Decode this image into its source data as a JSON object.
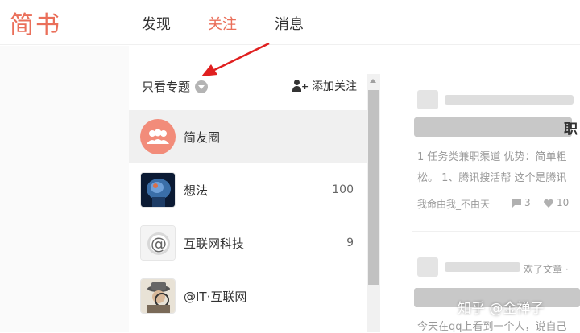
{
  "header": {
    "logo": "简书",
    "nav": [
      {
        "label": "发现",
        "active": false
      },
      {
        "label": "关注",
        "active": true
      },
      {
        "label": "消息",
        "active": false
      }
    ],
    "accent_color": "#ea6f5a"
  },
  "panel": {
    "filter_label": "只看专题",
    "add_follow_label": "添加关注",
    "items": [
      {
        "name": "简友圈",
        "count": "",
        "icon": "users-icon"
      },
      {
        "name": "想法",
        "count": "100",
        "icon": "brain-image"
      },
      {
        "name": "互联网科技",
        "count": "9",
        "icon": "at-sign-image"
      },
      {
        "name": "@IT·互联网",
        "count": "",
        "icon": "detective-image"
      }
    ]
  },
  "feed": {
    "post1": {
      "title_tail": "职",
      "excerpt_line1": "1 任务类兼职渠道 优势：简单粗",
      "excerpt_line2": "松。 1、腾讯搜活帮 这个是腾讯",
      "author": "我命由我_不由天",
      "comments": "3",
      "likes": "10"
    },
    "post2": {
      "action": "欢了文章 ·",
      "excerpt_line1": "今天在qq上看到一个人，说自己"
    }
  },
  "watermark": "知乎 @金禅子"
}
